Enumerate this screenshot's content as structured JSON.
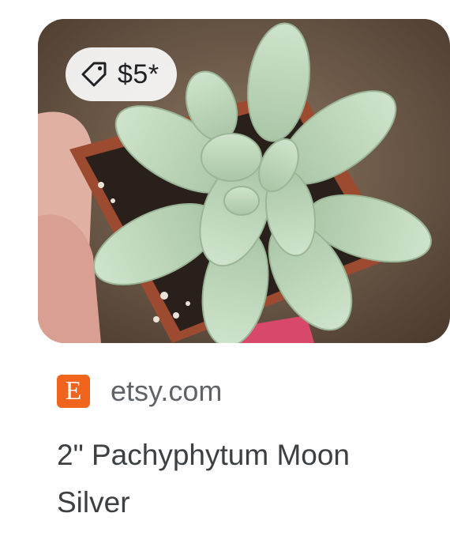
{
  "result": {
    "price": "$5*",
    "source_domain": "etsy.com",
    "favicon_letter": "E",
    "favicon_color": "#f1641e",
    "title": "2\" Pachyphytum Moon Silver"
  },
  "icons": {
    "price_tag": "tag-icon"
  }
}
